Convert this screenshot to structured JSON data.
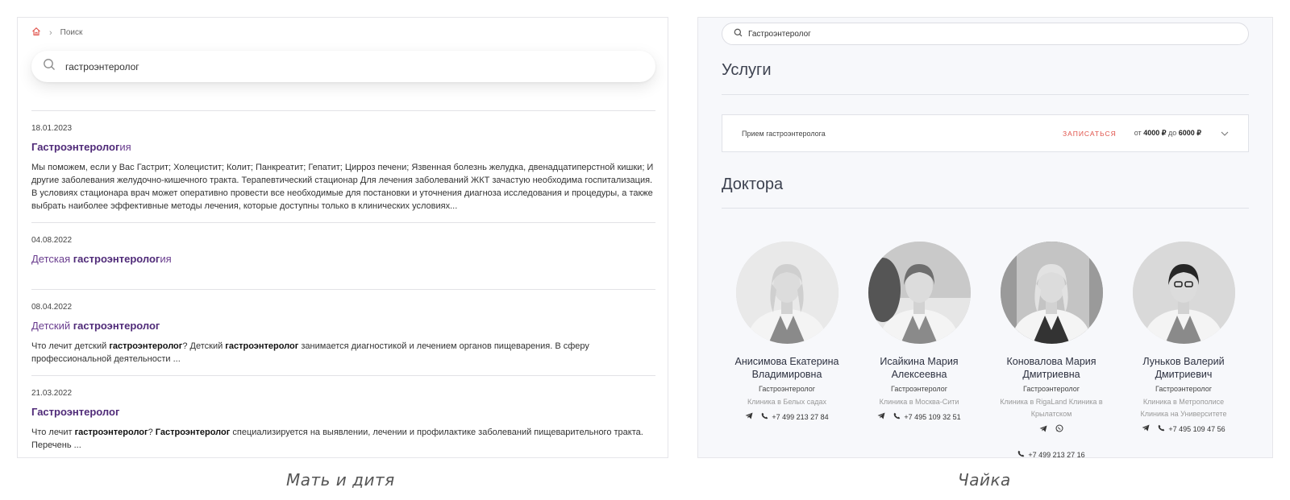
{
  "left": {
    "breadcrumb": {
      "current": "Поиск"
    },
    "search": {
      "value": "гастроэнтеролог"
    },
    "results": [
      {
        "date": "18.01.2023",
        "title": [
          {
            "t": "Гастроэнтеролог",
            "b": true
          },
          {
            "t": "ия",
            "b": false
          }
        ],
        "desc": [
          {
            "t": "Мы поможем, если у Вас Гастрит; Холецистит; Колит; Панкреатит; Гепатит; Цирроз печени; Язвенная болезнь желудка, двенадцатиперстной кишки; И другие заболевания желудочно-кишечного тракта. Терапевтический стационар Для лечения заболеваний ЖКТ зачастую необходима госпитализация. В условиях стационара врач может оперативно провести все необходимые для постановки и уточнения диагноза исследования и процедуры, а также выбрать наиболее эффективные методы лечения, которые доступны только в клинических условиях...",
            "b": false
          }
        ]
      },
      {
        "date": "04.08.2022",
        "title": [
          {
            "t": "Детская ",
            "b": false
          },
          {
            "t": "гастроэнтеролог",
            "b": true
          },
          {
            "t": "ия",
            "b": false
          }
        ],
        "desc": []
      },
      {
        "date": "08.04.2022",
        "title": [
          {
            "t": "Детский ",
            "b": false
          },
          {
            "t": "гастроэнтеролог",
            "b": true
          }
        ],
        "desc": [
          {
            "t": "Что лечит детский ",
            "b": false
          },
          {
            "t": "гастроэнтеролог",
            "b": true
          },
          {
            "t": "? Детский ",
            "b": false
          },
          {
            "t": "гастроэнтеролог",
            "b": true
          },
          {
            "t": " занимается диагностикой и лечением органов пищеварения. В сферу профессиональной деятельности ...",
            "b": false
          }
        ]
      },
      {
        "date": "21.03.2022",
        "title": [
          {
            "t": "Гастроэнтеролог",
            "b": true
          }
        ],
        "desc": [
          {
            "t": "Что лечит ",
            "b": false
          },
          {
            "t": "гастроэнтеролог",
            "b": true
          },
          {
            "t": "? ",
            "b": false
          },
          {
            "t": "Гастроэнтеролог",
            "b": true
          },
          {
            "t": " специализируется на выявлении, лечении и профилактике заболеваний пищеварительного тракта. Перечень ...",
            "b": false
          }
        ]
      }
    ],
    "caption": "Мать и дитя"
  },
  "right": {
    "search": {
      "value": "Гастроэнтеролог"
    },
    "services_heading": "Услуги",
    "service": {
      "name": "Прием гастроэнтеролога",
      "book_label": "ЗАПИСАТЬСЯ",
      "price_from": "от",
      "price_min": "4000 ₽",
      "price_to": "до",
      "price_max": "6000 ₽"
    },
    "doctors_heading": "Доктора",
    "doctors": [
      {
        "name": "Анисимова Екатерина Владимировна",
        "spec": "Гастроэнтеролог",
        "clinic": "Клиника в Белых садах",
        "phone": "+7 499 213 27 84",
        "whatsapp": false
      },
      {
        "name": "Исайкина Мария Алексеевна",
        "spec": "Гастроэнтеролог",
        "clinic": "Клиника в Москва-Сити",
        "phone": "+7 495 109 32 51",
        "whatsapp": false
      },
      {
        "name": "Коновалова Мария Дмитриевна",
        "spec": "Гастроэнтеролог",
        "clinic": "Клиника в RigaLand Клиника в Крылатском",
        "phone": "+7 499 213 27 16",
        "whatsapp": true
      },
      {
        "name": "Луньков Валерий Дмитриевич",
        "spec": "Гастроэнтеролог",
        "clinic": "Клиника в Метрополисе Клиника на Университете",
        "phone": "+7 495 109 47 56",
        "whatsapp": false
      }
    ],
    "caption": "Чайка"
  },
  "colors": {
    "accent_purple": "#4f2a78",
    "book_red": "#e0524a",
    "home_icon": "#e0524a"
  }
}
